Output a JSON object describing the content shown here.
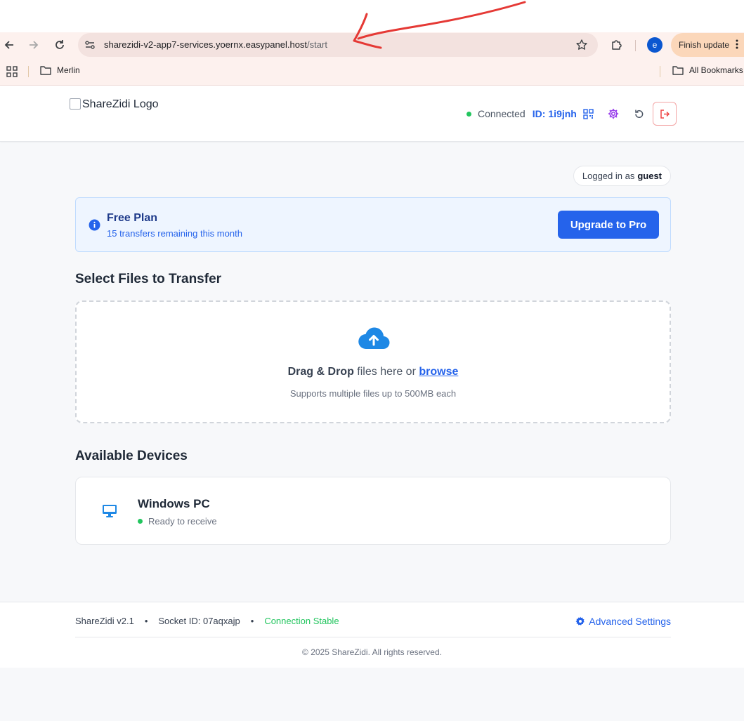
{
  "browser": {
    "url_host": "sharezidi-v2-app7-services.yoernx.easypanel.host",
    "url_path": "/start",
    "profile_initial": "e",
    "update_label": "Finish update",
    "bookmarks": [
      {
        "label": "Merlin",
        "icon": "folder-icon"
      },
      {
        "label": "All Bookmarks",
        "icon": "folder-icon"
      }
    ],
    "annotation_color": "#e53935"
  },
  "header": {
    "logo_alt": "ShareZidi Logo",
    "status_text": "Connected",
    "id_label": "ID:",
    "id_value": "1i9jnh",
    "icons": [
      "qr-code-icon",
      "gear-icon",
      "refresh-icon",
      "logout-icon"
    ]
  },
  "session": {
    "prefix": "Logged in as",
    "user": "guest"
  },
  "plan": {
    "title": "Free Plan",
    "subtitle": "15 transfers remaining this month",
    "upgrade_label": "Upgrade to Pro"
  },
  "transfer": {
    "section_title": "Select Files to Transfer",
    "drag_bold": "Drag & Drop",
    "drag_text": " files here or ",
    "browse_label": "browse",
    "hint": "Supports multiple files up to 500MB each"
  },
  "devices": {
    "section_title": "Available Devices",
    "items": [
      {
        "name": "Windows PC",
        "status": "Ready to receive",
        "icon": "monitor-icon"
      }
    ]
  },
  "footer": {
    "version": "ShareZidi v2.1",
    "socket": "Socket ID: 07aqxajp",
    "connection": "Connection Stable",
    "advanced_label": "Advanced Settings",
    "copyright": "© 2025 ShareZidi. All rights reserved."
  },
  "colors": {
    "primary": "#2563eb",
    "success": "#22c55e",
    "plan_bg": "#eef5ff",
    "danger": "#ef4444"
  }
}
